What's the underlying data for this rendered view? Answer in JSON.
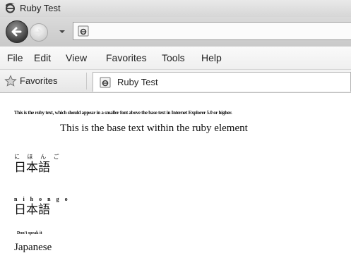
{
  "window": {
    "title": "Ruby Test"
  },
  "navigation": {
    "address_value": "",
    "icons": [
      "back-arrow-icon",
      "forward-arrow-icon",
      "dropdown-arrow-icon",
      "ie-page-icon"
    ]
  },
  "menu": {
    "items": [
      "File",
      "Edit",
      "View",
      "Favorites",
      "Tools",
      "Help"
    ]
  },
  "favorites_bar": {
    "favorites_label": "Favorites",
    "tab_label": "Ruby Test"
  },
  "content": {
    "ruby_text": "This is the ruby text, which should appear in a smaller font above the base text in Internet Explorer 5.0 or higher.",
    "base_text": "This is the base text within the ruby element",
    "examples": [
      {
        "ruby": "に ほ ん ご",
        "base": "日本語"
      },
      {
        "ruby": "n i h o n g o",
        "base": "日本語"
      },
      {
        "ruby": "Don't speak it",
        "base": "Japanese"
      }
    ]
  },
  "colors": {
    "chrome_gradient_top": "#e9e9e9",
    "chrome_gradient_bottom": "#c9c9c9",
    "content_background": "#ffffff",
    "text": "#111111"
  }
}
